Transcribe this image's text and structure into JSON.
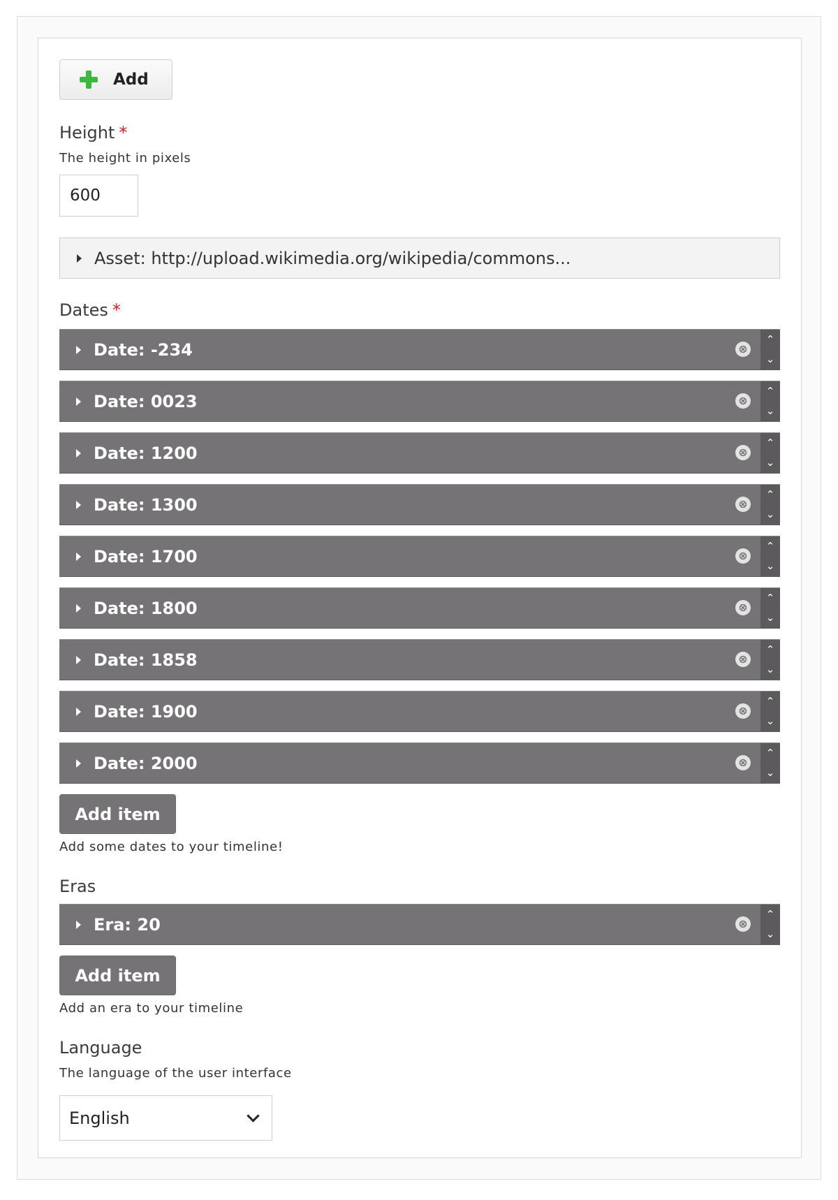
{
  "add_button": {
    "label": "Add",
    "icon": "plus-icon"
  },
  "height": {
    "label": "Height",
    "required_mark": "*",
    "description": "The height in pixels",
    "value": "600"
  },
  "asset": {
    "label": "Asset: http://upload.wikimedia.org/wikipedia/commons..."
  },
  "dates": {
    "label": "Dates",
    "required_mark": "*",
    "items": [
      {
        "label": "Date: -234"
      },
      {
        "label": "Date: 0023"
      },
      {
        "label": "Date: 1200"
      },
      {
        "label": "Date: 1300"
      },
      {
        "label": "Date: 1700"
      },
      {
        "label": "Date: 1800"
      },
      {
        "label": "Date: 1858"
      },
      {
        "label": "Date: 1900"
      },
      {
        "label": "Date: 2000"
      }
    ],
    "add_item_label": "Add item",
    "help": "Add some dates to your timeline!"
  },
  "eras": {
    "label": "Eras",
    "items": [
      {
        "label": "Era: 20"
      }
    ],
    "add_item_label": "Add item",
    "help": "Add an era to your timeline"
  },
  "language": {
    "label": "Language",
    "description": "The language of the user interface",
    "selected": "English"
  },
  "icons": {
    "remove": "⊗",
    "move_up": "⌃",
    "move_down": "⌄"
  },
  "colors": {
    "bar": "#757375",
    "add_icon": "#3cb93c",
    "required": "#d11f1f"
  }
}
